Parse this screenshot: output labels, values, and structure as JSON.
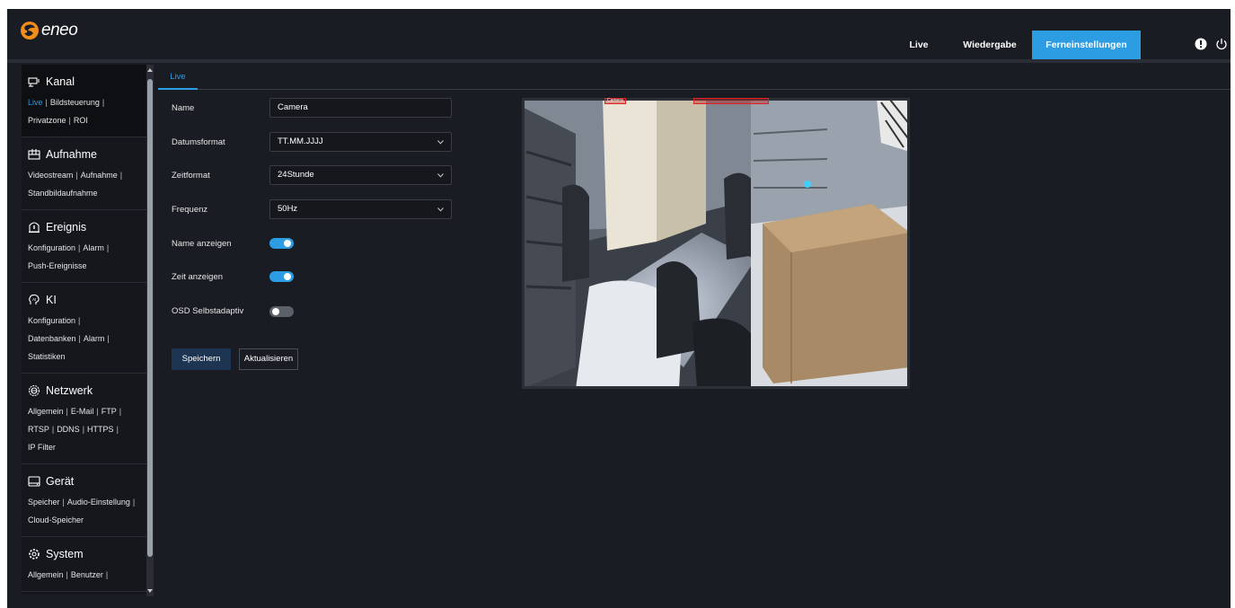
{
  "brand": {
    "logo_text": "eneo"
  },
  "nav": {
    "live": "Live",
    "playback": "Wiedergabe",
    "remote_settings": "Ferneinstellungen"
  },
  "sidebar": {
    "sections": [
      {
        "title": "Kanal",
        "icon": "monitor-camera-icon",
        "links": [
          "Live",
          "Bildsteuerung",
          "Privatzone",
          "ROI"
        ]
      },
      {
        "title": "Aufnahme",
        "icon": "recording-icon",
        "links": [
          "Videostream",
          "Aufnahme",
          "Standbildaufnahme"
        ]
      },
      {
        "title": "Ereignis",
        "icon": "event-alarm-icon",
        "links": [
          "Konfiguration",
          "Alarm",
          "Push-Ereignisse"
        ]
      },
      {
        "title": "KI",
        "icon": "ai-brain-icon",
        "links": [
          "Konfiguration",
          "Datenbanken",
          "Alarm",
          "Statistiken"
        ]
      },
      {
        "title": "Netzwerk",
        "icon": "network-globe-icon",
        "links": [
          "Allgemein",
          "E-Mail",
          "FTP",
          "RTSP",
          "DDNS",
          "HTTPS",
          "IP Filter"
        ]
      },
      {
        "title": "Gerät",
        "icon": "device-storage-icon",
        "links": [
          "Speicher",
          "Audio-Einstellung",
          "Cloud-Speicher"
        ]
      },
      {
        "title": "System",
        "icon": "system-gear-icon",
        "links": [
          "Allgemein",
          "Benutzer"
        ]
      }
    ]
  },
  "tab": {
    "label": "Live"
  },
  "form": {
    "name_label": "Name",
    "name_value": "Camera",
    "date_format_label": "Datumsformat",
    "date_format_value": "TT.MM.JJJJ",
    "time_format_label": "Zeitformat",
    "time_format_value": "24Stunde",
    "frequency_label": "Frequenz",
    "frequency_value": "50Hz",
    "show_name_label": "Name anzeigen",
    "show_name_on": true,
    "show_time_label": "Zeit anzeigen",
    "show_time_on": true,
    "osd_adaptive_label": "OSD Selbstadaptiv",
    "osd_adaptive_on": false
  },
  "buttons": {
    "save": "Speichern",
    "refresh": "Aktualisieren"
  },
  "video": {
    "osd_name": "Camera"
  },
  "colors": {
    "accent": "#2c9ce3",
    "background": "#1a1c23",
    "save_button": "#1d3550"
  }
}
